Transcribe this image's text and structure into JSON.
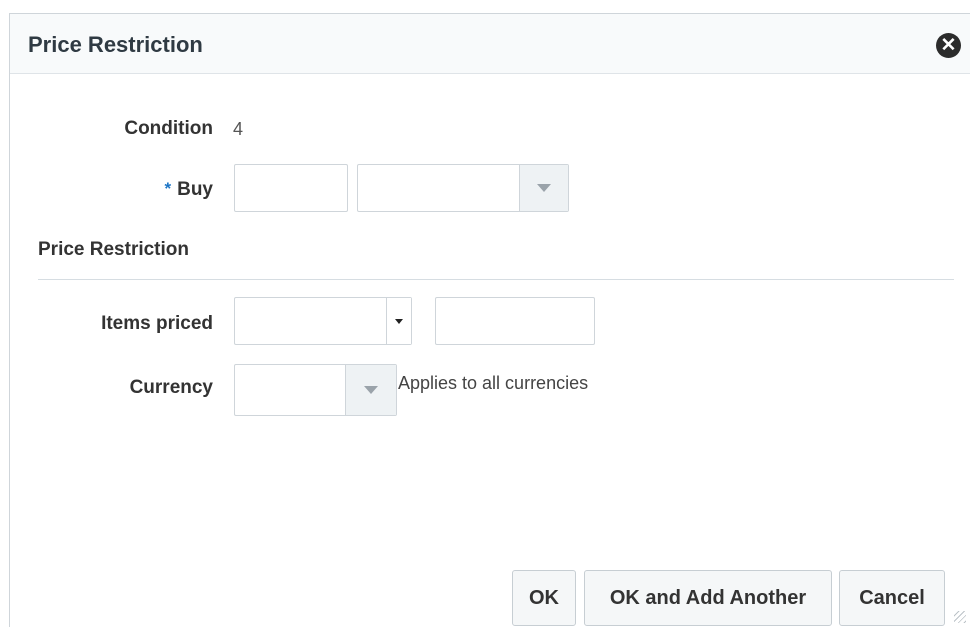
{
  "dialog": {
    "title": "Price Restriction",
    "close_icon": "close-circle-icon"
  },
  "form": {
    "condition_label": "Condition",
    "condition_value": "4",
    "buy_required_marker": "*",
    "buy_label": "Buy",
    "buy_quantity_value": "",
    "buy_type_value": "",
    "section_title": "Price Restriction",
    "items_priced_label": "Items priced",
    "items_priced_select_value": "",
    "items_priced_amount_value": "",
    "currency_label": "Currency",
    "currency_value": "",
    "currency_note": "Applies to all currencies"
  },
  "buttons": {
    "ok": "OK",
    "ok_add_another": "OK and Add Another",
    "cancel": "Cancel"
  },
  "colors": {
    "required_marker": "#1b74c5",
    "header_bg": "#f8fafb"
  }
}
